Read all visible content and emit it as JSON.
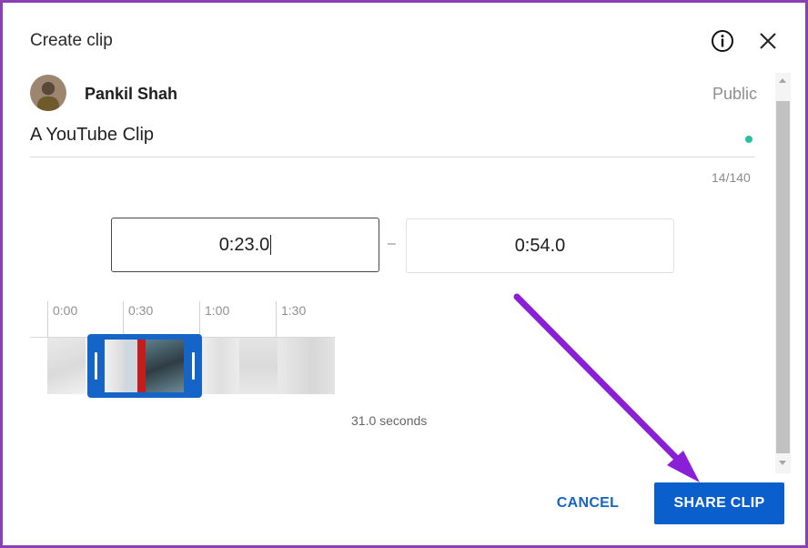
{
  "dialog": {
    "title": "Create clip",
    "user_name": "Pankil Shah",
    "visibility": "Public",
    "clip_title": "A YouTube Clip",
    "char_count": "14/140"
  },
  "time_range": {
    "start": "0:23.0",
    "separator": "–",
    "end": "0:54.0"
  },
  "timeline": {
    "ticks": [
      "0:00",
      "0:30",
      "1:00",
      "1:30"
    ],
    "duration": "31.0 seconds"
  },
  "actions": {
    "cancel_label": "CANCEL",
    "share_label": "SHARE CLIP"
  },
  "colors": {
    "page_background": "#8a3fb5",
    "primary": "#0a5fcc",
    "selection": "#1565c8",
    "status_dot": "#2bbfa2",
    "annotation_arrow": "#8b1fd8"
  },
  "icons": {
    "info": "info-icon",
    "close": "close-icon",
    "annotation": "arrow-annotation-icon"
  }
}
